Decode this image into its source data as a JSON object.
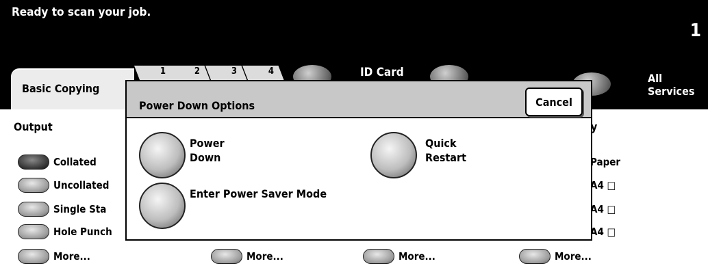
{
  "status": {
    "message": "Ready to scan your job.",
    "count": "1"
  },
  "tabs": {
    "basic": "Basic Copying",
    "numbered": [
      "1",
      "2",
      "3",
      "4"
    ],
    "id_card": "ID Card",
    "all_services": "All Services"
  },
  "background": {
    "output_label": "Output",
    "right_label": "ly",
    "output_options": [
      "Collated",
      "Uncollated",
      "Single Sta",
      "Hole Punch",
      "More..."
    ],
    "more_labels": [
      "More...",
      "More...",
      "More..."
    ],
    "paper_labels": [
      "Paper",
      "A4 □",
      "A4 □",
      "A4 □"
    ]
  },
  "dialog": {
    "title": "Power Down Options",
    "cancel": "Cancel",
    "power_down": "Power Down",
    "quick_restart": "Quick Restart",
    "power_saver": "Enter Power Saver Mode"
  }
}
